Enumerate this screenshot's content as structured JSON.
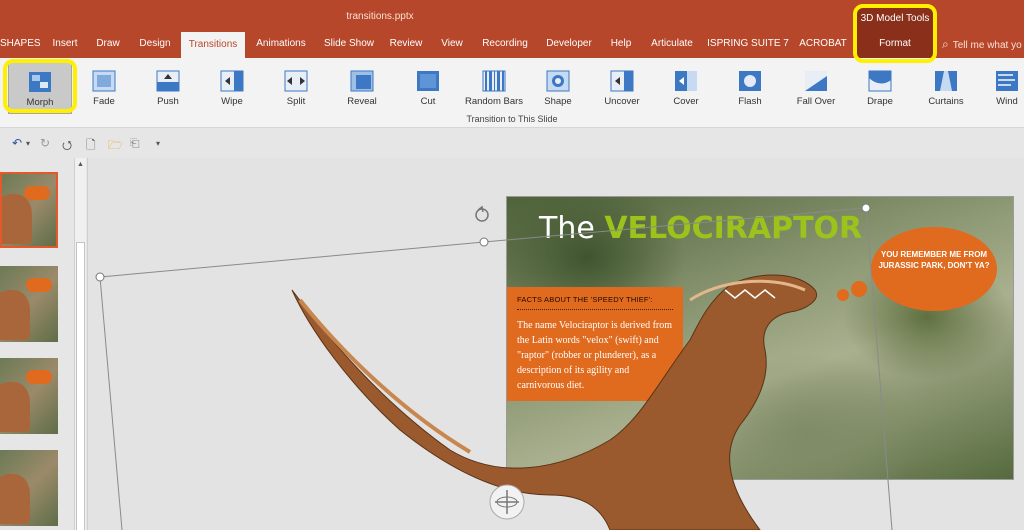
{
  "window": {
    "title": "transitions.pptx"
  },
  "contextual": {
    "group": "3D Model Tools",
    "tab": "Format"
  },
  "tabs": [
    {
      "label": "SHAPES"
    },
    {
      "label": "Insert"
    },
    {
      "label": "Draw"
    },
    {
      "label": "Design"
    },
    {
      "label": "Transitions",
      "active": true
    },
    {
      "label": "Animations"
    },
    {
      "label": "Slide Show"
    },
    {
      "label": "Review"
    },
    {
      "label": "View"
    },
    {
      "label": "Recording"
    },
    {
      "label": "Developer"
    },
    {
      "label": "Help"
    },
    {
      "label": "Articulate"
    },
    {
      "label": "ISPRING SUITE 7"
    },
    {
      "label": "ACROBAT"
    }
  ],
  "tell_me": "Tell me what yo",
  "ribbon": {
    "group_label": "Transition to This Slide",
    "transitions": [
      {
        "label": "Morph",
        "icon": "morph-icon",
        "selected": true
      },
      {
        "label": "Fade",
        "icon": "fade-icon"
      },
      {
        "label": "Push",
        "icon": "push-icon"
      },
      {
        "label": "Wipe",
        "icon": "wipe-icon"
      },
      {
        "label": "Split",
        "icon": "split-icon"
      },
      {
        "label": "Reveal",
        "icon": "reveal-icon"
      },
      {
        "label": "Cut",
        "icon": "cut-icon"
      },
      {
        "label": "Random Bars",
        "icon": "random-bars-icon"
      },
      {
        "label": "Shape",
        "icon": "shape-icon"
      },
      {
        "label": "Uncover",
        "icon": "uncover-icon"
      },
      {
        "label": "Cover",
        "icon": "cover-icon"
      },
      {
        "label": "Flash",
        "icon": "flash-icon"
      },
      {
        "label": "Fall Over",
        "icon": "fall-over-icon"
      },
      {
        "label": "Drape",
        "icon": "drape-icon"
      },
      {
        "label": "Curtains",
        "icon": "curtains-icon"
      },
      {
        "label": "Wind",
        "icon": "wind-icon"
      }
    ]
  },
  "slide": {
    "title_plain": "The ",
    "title_accent": "VELOCIRAPTOR",
    "facts_heading": "FACTS ABOUT THE 'SPEEDY THIEF':",
    "facts_body": "The name Velociraptor is derived from the Latin words \"velox\" (swift) and \"raptor\" (robber or plunderer), as a description of its agility and carnivorous diet.",
    "speech_bubble": "YOU REMEMBER ME FROM JURASSIC PARK, DON'T YA?"
  },
  "colors": {
    "ppt_red": "#b7472a",
    "accent_green": "#9bc31c",
    "bubble_orange": "#e06a1d",
    "highlight_yellow": "#ffef00"
  }
}
